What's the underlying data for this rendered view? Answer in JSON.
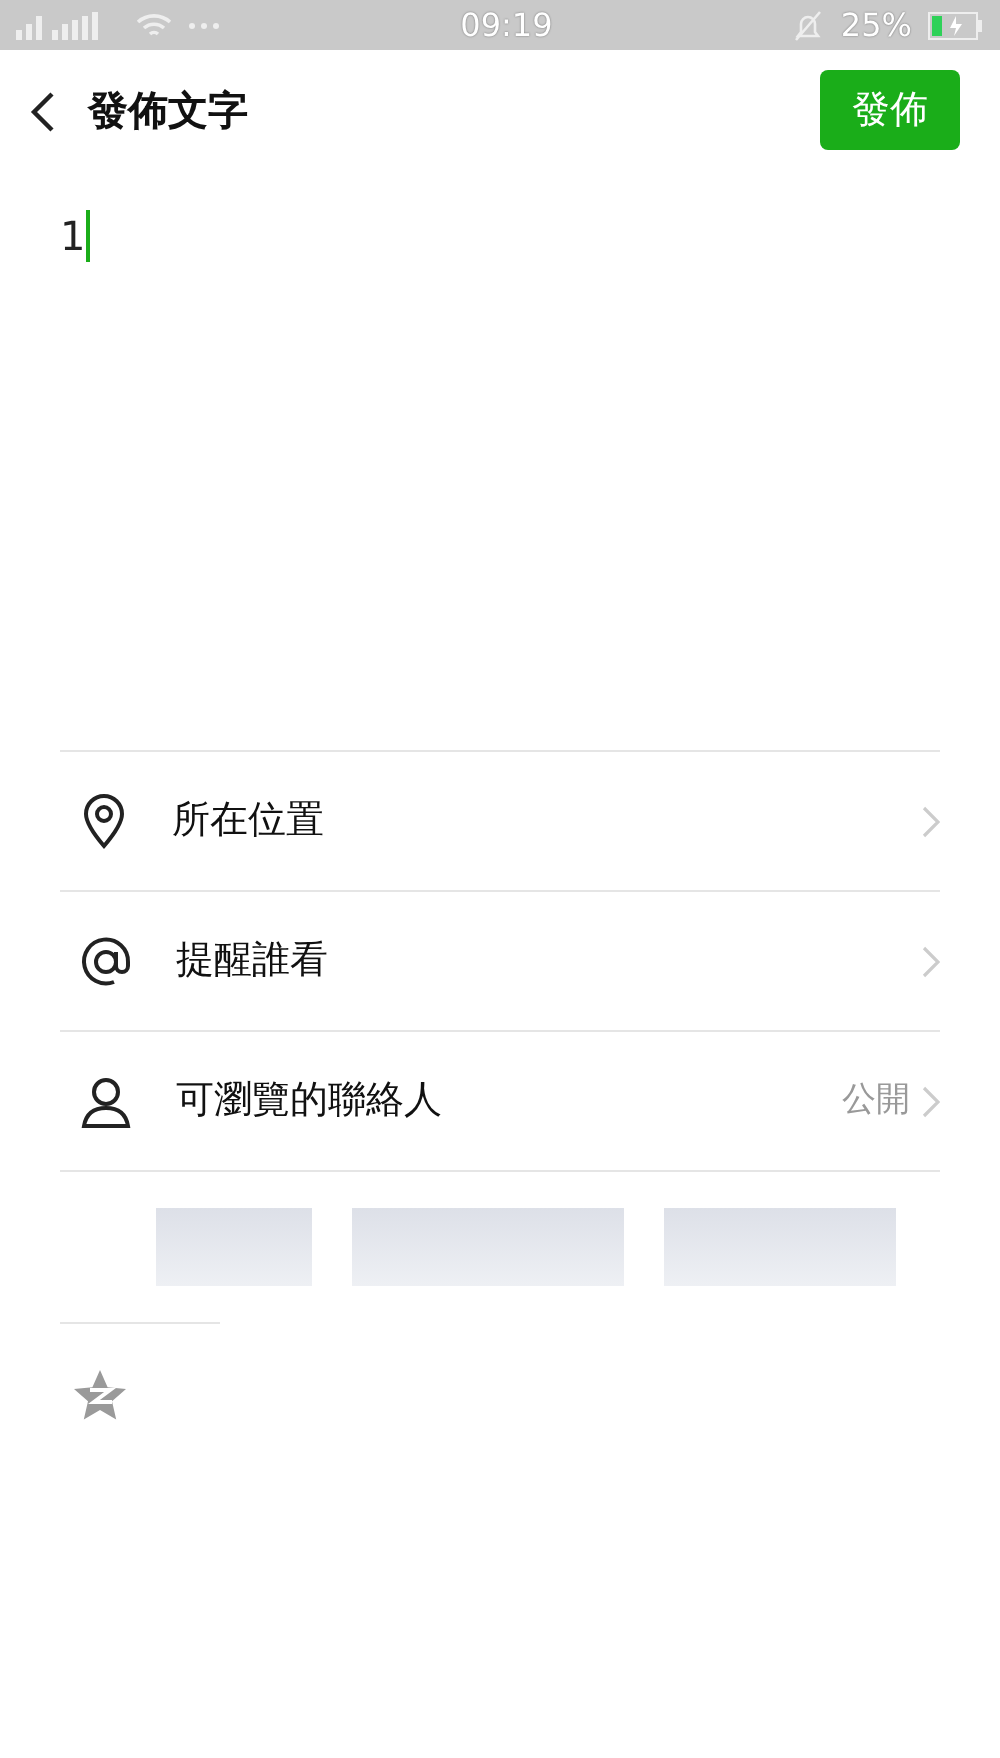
{
  "status_bar": {
    "time": "09:19",
    "battery": "25%"
  },
  "header": {
    "title": "發佈文字",
    "post_button": "發佈"
  },
  "editor": {
    "value": "1"
  },
  "options": [
    {
      "kind": "location",
      "label": "所在位置"
    },
    {
      "kind": "mention",
      "label": "提醒誰看"
    },
    {
      "kind": "contacts",
      "label": "可瀏覽的聯絡人",
      "value": "公開"
    }
  ]
}
